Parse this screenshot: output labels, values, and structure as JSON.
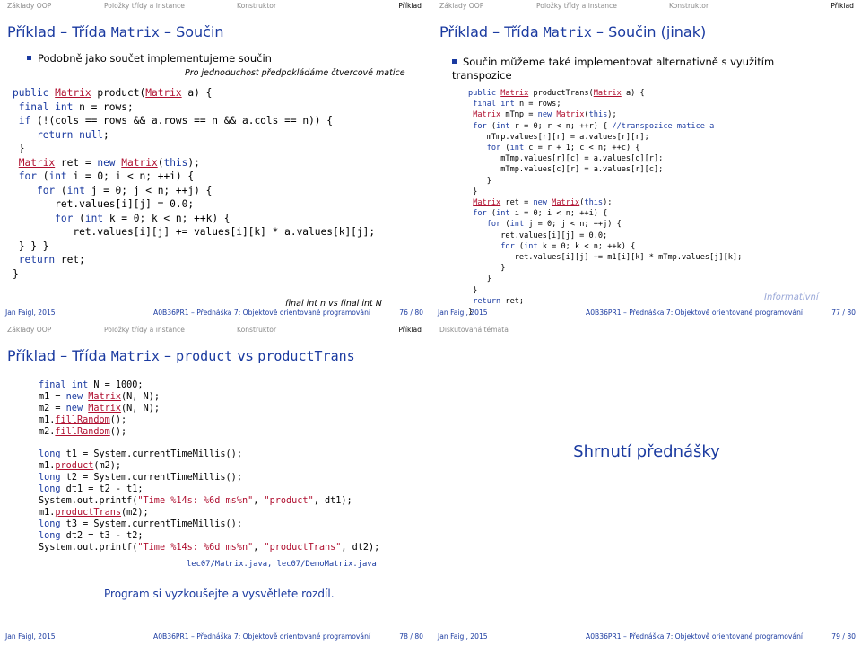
{
  "nav": {
    "basics": "Základy OOP",
    "items": "Položky třídy a instance",
    "constructor": "Konstruktor",
    "example": "Příklad",
    "discussed": "Diskutovaná témata"
  },
  "footer": {
    "author": "Jan Faigl, 2015",
    "course": "A0B36PR1 – Přednáška 7: Objektově orientované programování"
  },
  "slides": [
    {
      "title_prefix": "Příklad – Třída ",
      "title_mono": "Matrix",
      "title_suffix": " – Součin",
      "bullet": "Podobně jako součet implementujeme součin",
      "note_top": "Pro jednoduchost předpokládáme čtvercové matice",
      "note_bottom": "final int n vs final int N",
      "page": "76 / 80"
    },
    {
      "title_prefix": "Příklad – Třída ",
      "title_mono": "Matrix",
      "title_suffix": " – Součin (jinak)",
      "bullet": "Součin můžeme také implementovat alternativně s využitím transpozice",
      "badge": "Informativní",
      "page": "77 / 80"
    },
    {
      "title_prefix": "Příklad – Třída ",
      "title_mono": "Matrix",
      "title_mid": " – ",
      "title_mono2": "product",
      "title_vs": " vs ",
      "title_mono3": "productTrans",
      "files": "lec07/Matrix.java, lec07/DemoMatrix.java",
      "task": "Program si vyzkoušejte a vysvětlete rozdíl.",
      "page": "78 / 80"
    },
    {
      "center_title": "Shrnutí přednášky",
      "page": "79 / 80"
    }
  ]
}
